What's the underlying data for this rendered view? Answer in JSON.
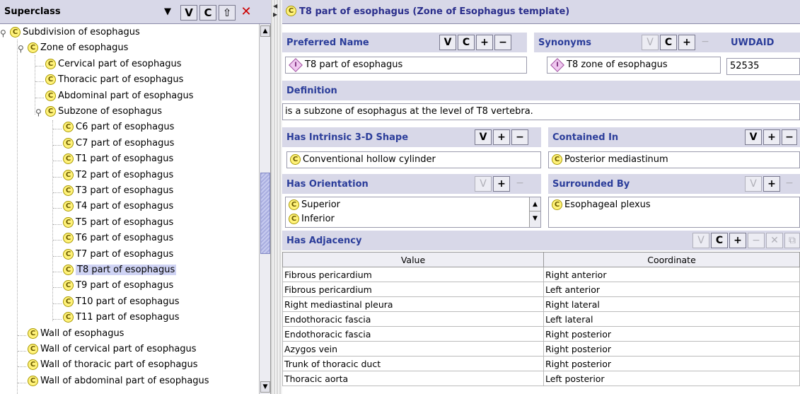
{
  "left_header": {
    "label": "Superclass",
    "dropdown_glyph": "▼",
    "btn_v": "V",
    "btn_c": "C",
    "btn_home": "⇧",
    "btn_delete": "✕"
  },
  "tree": [
    {
      "label": "Subdivision of esophagus",
      "level": 0,
      "expanded": true
    },
    {
      "label": "Zone of esophagus",
      "level": 1,
      "expanded": true
    },
    {
      "label": "Cervical part of esophagus",
      "level": 2
    },
    {
      "label": "Thoracic part of esophagus",
      "level": 2
    },
    {
      "label": "Abdominal part of esophagus",
      "level": 2
    },
    {
      "label": "Subzone of esophagus",
      "level": 2,
      "expanded": true
    },
    {
      "label": "C6 part of esophagus",
      "level": 3
    },
    {
      "label": "C7 part of esophagus",
      "level": 3
    },
    {
      "label": "T1 part of esophagus",
      "level": 3
    },
    {
      "label": "T2 part of esophagus",
      "level": 3
    },
    {
      "label": "T3 part of esophagus",
      "level": 3
    },
    {
      "label": "T4 part of esophagus",
      "level": 3
    },
    {
      "label": "T5 part of esophagus",
      "level": 3
    },
    {
      "label": "T6 part of esophagus",
      "level": 3
    },
    {
      "label": "T7 part of esophagus",
      "level": 3
    },
    {
      "label": "T8 part of esophagus",
      "level": 3,
      "selected": true
    },
    {
      "label": "T9 part of esophagus",
      "level": 3
    },
    {
      "label": "T10 part of esophagus",
      "level": 3
    },
    {
      "label": "T11 part of esophagus",
      "level": 3
    },
    {
      "label": "Wall of esophagus",
      "level": 1
    },
    {
      "label": "Wall of cervical part of esophagus",
      "level": 1
    },
    {
      "label": "Wall of thoracic part of esophagus",
      "level": 1
    },
    {
      "label": "Wall of abdominal part of esophagus",
      "level": 1
    }
  ],
  "instance": {
    "title": "T8 part of esophagus  (Zone of Esophagus template)"
  },
  "slots": {
    "preferred_name": {
      "label": "Preferred Name",
      "value": "T8 part of esophagus"
    },
    "synonyms": {
      "label": "Synonyms",
      "value": "T8 zone of esophagus"
    },
    "uwdaid": {
      "label": "UWDAID",
      "value": "52535"
    },
    "definition": {
      "label": "Definition",
      "value": "is a subzone of esophagus at the level of T8 vertebra."
    },
    "shape": {
      "label": "Has Intrinsic 3-D Shape",
      "value": "Conventional hollow cylinder"
    },
    "contained_in": {
      "label": "Contained In",
      "value": "Posterior mediastinum"
    },
    "orientation": {
      "label": "Has Orientation",
      "values": [
        "Superior",
        "Inferior"
      ]
    },
    "surrounded_by": {
      "label": "Surrounded By",
      "value": "Esophageal plexus"
    },
    "adjacency": {
      "label": "Has Adjacency",
      "columns": [
        "Value",
        "Coordinate"
      ],
      "rows": [
        [
          "Fibrous pericardium",
          "Right anterior"
        ],
        [
          "Fibrous pericardium",
          "Left anterior"
        ],
        [
          "Right mediastinal pleura",
          "Right lateral"
        ],
        [
          "Endothoracic fascia",
          "Left lateral"
        ],
        [
          "Endothoracic fascia",
          "Right posterior"
        ],
        [
          "Azygos vein",
          "Right posterior"
        ],
        [
          "Trunk of thoracic duct",
          "Right posterior"
        ],
        [
          "Thoracic aorta",
          "Left posterior"
        ]
      ]
    }
  },
  "glyphs": {
    "v": "V",
    "c": "C",
    "plus": "+",
    "minus": "−",
    "x": "✕",
    "copy": "⧉",
    "class_icon": "C",
    "instance_icon": "I",
    "up": "▲",
    "down": "▼",
    "pin": "⚲"
  },
  "colors": {
    "header_bg": "#d8d8e8",
    "slot_label": "#2b3d9a",
    "class_icon": "#fff27a",
    "selection": "#cfd3f4"
  }
}
